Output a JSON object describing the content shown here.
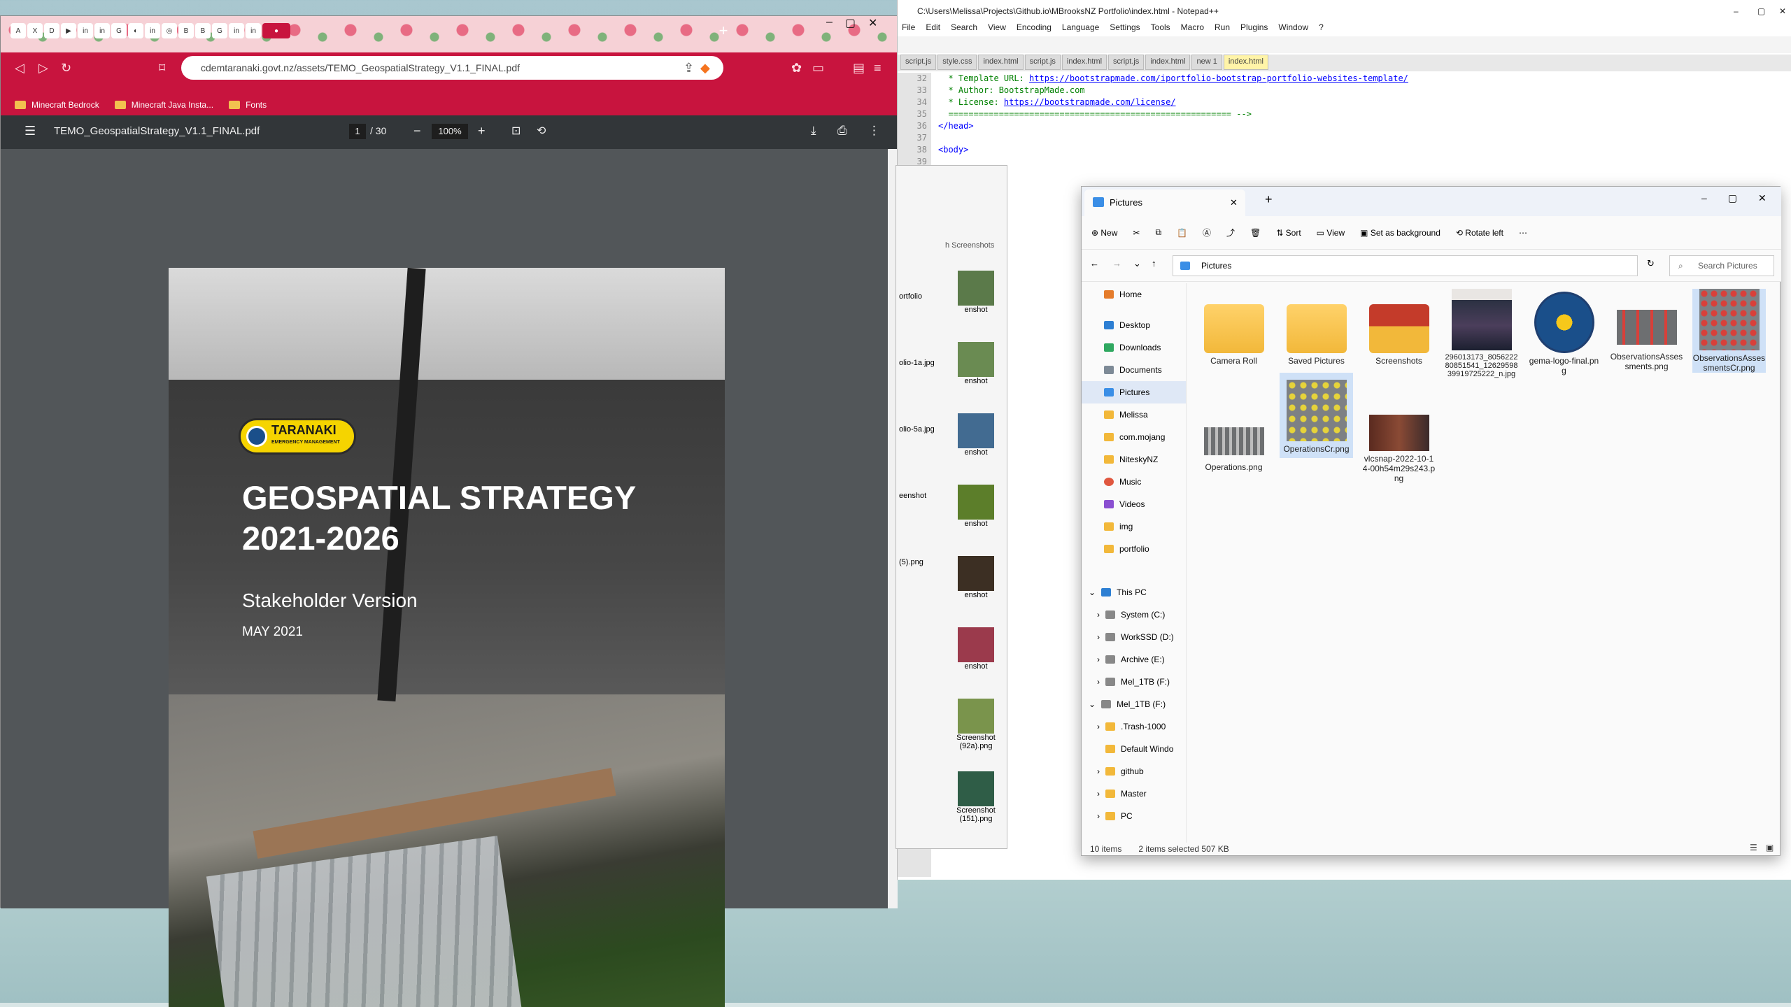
{
  "browser": {
    "url": "cdemtaranaki.govt.nz/assets/TEMO_GeospatialStrategy_V1.1_FINAL.pdf",
    "bookmarks": [
      "Minecraft Bedrock",
      "Minecraft Java Insta...",
      "Fonts"
    ],
    "pdf": {
      "filename": "TEMO_GeospatialStrategy_V1.1_FINAL.pdf",
      "page": "1",
      "page_total": "/ 30",
      "zoom": "100%"
    }
  },
  "document": {
    "logo_text": "TARANAKI",
    "logo_sub": "EMERGENCY MANAGEMENT",
    "title_line1": "GEOSPATIAL STRATEGY",
    "title_line2": "2021-2026",
    "subtitle": "Stakeholder Version",
    "date": "MAY 2021"
  },
  "notepad": {
    "title": "C:\\Users\\Melissa\\Projects\\Github.io\\MBrooksNZ Portfolio\\index.html - Notepad++",
    "menu": [
      "File",
      "Edit",
      "Search",
      "View",
      "Encoding",
      "Language",
      "Settings",
      "Tools",
      "Macro",
      "Run",
      "Plugins",
      "Window",
      "?"
    ],
    "tabs": [
      "script.js",
      "style.css",
      "index.html",
      "script.js",
      "index.html",
      "script.js",
      "index.html",
      "new 1",
      "index.html"
    ],
    "line_numbers": [
      "32",
      "33",
      "34",
      "35",
      "36",
      "37",
      "38",
      "39"
    ],
    "code": [
      "  * Template URL: ",
      "  * Author: BootstrapMade.com",
      "  * License: ",
      "  ======================================================== -->",
      "</head>",
      "",
      "<body>",
      ""
    ],
    "template_url": "https://bootstrapmade.com/iportfolio-bootstrap-portfolio-websites-template/",
    "license_url": "https://bootstrapmade.com/license/"
  },
  "explorer": {
    "tab": "Pictures",
    "commands": [
      "New",
      "Sort",
      "View",
      "Set as background",
      "Rotate left"
    ],
    "path": "Pictures",
    "search": "Search Pictures",
    "nav": [
      "Home",
      "Desktop",
      "Downloads",
      "Documents",
      "Pictures",
      "Melissa",
      "com.mojang",
      "NiteskyNZ",
      "Music",
      "Videos",
      "img",
      "portfolio",
      "This PC",
      "System (C:)",
      "WorkSSD (D:)",
      "Archive (E:)",
      "Mel_1TB (F:)",
      "Mel_1TB (F:)",
      ".Trash-1000",
      "Default Windo",
      "github",
      "Master",
      "PC"
    ],
    "files": [
      {
        "name": "Camera Roll",
        "kind": "folder"
      },
      {
        "name": "Saved Pictures",
        "kind": "folder"
      },
      {
        "name": "Screenshots",
        "kind": "folder"
      },
      {
        "name": "296013173_805622280851541_1262959839919725222_n.jpg",
        "kind": "image"
      },
      {
        "name": "gema-logo-final.png",
        "kind": "image"
      },
      {
        "name": "ObservationsAssessments.png",
        "kind": "image"
      },
      {
        "name": "ObservationsAssessmentsCr.png",
        "kind": "image"
      },
      {
        "name": "Operations.png",
        "kind": "image"
      },
      {
        "name": "OperationsCr.png",
        "kind": "image"
      },
      {
        "name": "vlcsnap-2022-10-14-00h54m29s243.png",
        "kind": "image"
      }
    ],
    "status_count": "10 items",
    "status_selected": "2 items selected  507 KB"
  },
  "back_explorer": {
    "search": "h Screenshots",
    "labels": [
      "enshot",
      "enshot",
      "enshot",
      "enshot",
      "enshot",
      "enshot",
      "Screenshot (92a).png",
      "Screenshot (151).png"
    ],
    "left_items": [
      "ortfolio",
      "olio-1a.jpg",
      "olio-5a.jpg",
      "eenshot (5).png"
    ]
  }
}
